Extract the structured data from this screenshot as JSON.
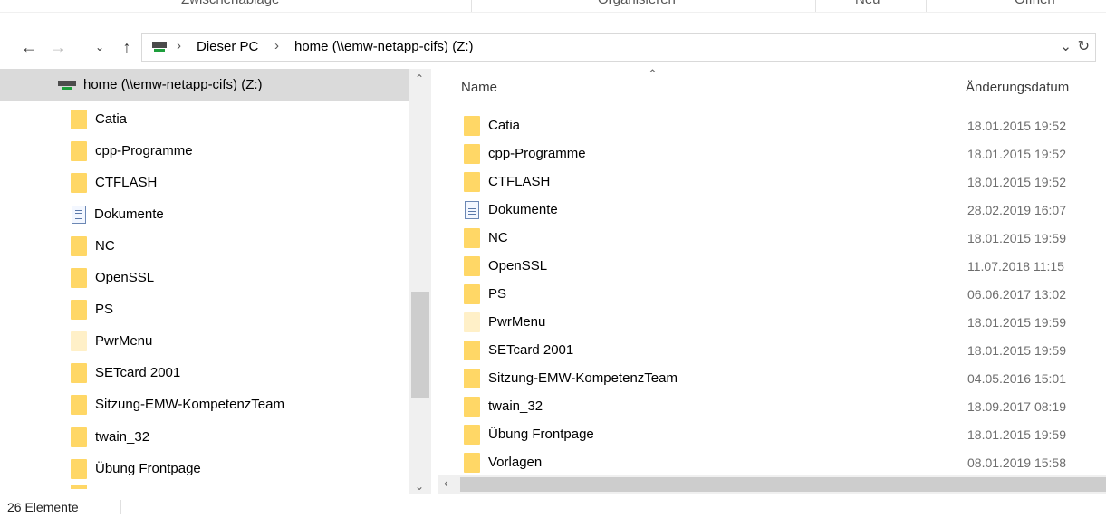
{
  "ribbon": {
    "groups": [
      "Zwischenablage",
      "Organisieren",
      "Neu",
      "Öffnen"
    ]
  },
  "nav": {
    "back_icon": "arrow-left-icon",
    "forward_icon": "arrow-right-icon",
    "recent_icon": "chevron-down-icon",
    "up_icon": "arrow-up-icon"
  },
  "address": {
    "breadcrumb": [
      "Dieser PC",
      "home (\\\\emw-netapp-cifs) (Z:)"
    ],
    "dropdown_icon": "chevron-down-icon",
    "refresh_icon": "refresh-icon"
  },
  "tree": {
    "selected": "home (\\\\emw-netapp-cifs) (Z:)",
    "items": [
      {
        "label": "Catia",
        "icon": "folder"
      },
      {
        "label": "cpp-Programme",
        "icon": "folder"
      },
      {
        "label": "CTFLASH",
        "icon": "folder"
      },
      {
        "label": "Dokumente",
        "icon": "document"
      },
      {
        "label": "NC",
        "icon": "folder"
      },
      {
        "label": "OpenSSL",
        "icon": "folder"
      },
      {
        "label": "PS",
        "icon": "folder"
      },
      {
        "label": "PwrMenu",
        "icon": "folder-hidden"
      },
      {
        "label": "SETcard 2001",
        "icon": "folder"
      },
      {
        "label": "Sitzung-EMW-KompetenzTeam",
        "icon": "folder"
      },
      {
        "label": "twain_32",
        "icon": "folder"
      },
      {
        "label": "Übung Frontpage",
        "icon": "folder"
      }
    ]
  },
  "list": {
    "columns": {
      "name": "Name",
      "modified": "Änderungsdatum"
    },
    "rows": [
      {
        "name": "Catia",
        "date": "18.01.2015 19:52",
        "icon": "folder"
      },
      {
        "name": "cpp-Programme",
        "date": "18.01.2015 19:52",
        "icon": "folder"
      },
      {
        "name": "CTFLASH",
        "date": "18.01.2015 19:52",
        "icon": "folder"
      },
      {
        "name": "Dokumente",
        "date": "28.02.2019 16:07",
        "icon": "document"
      },
      {
        "name": "NC",
        "date": "18.01.2015 19:59",
        "icon": "folder"
      },
      {
        "name": "OpenSSL",
        "date": "11.07.2018 11:15",
        "icon": "folder"
      },
      {
        "name": "PS",
        "date": "06.06.2017 13:02",
        "icon": "folder"
      },
      {
        "name": "PwrMenu",
        "date": "18.01.2015 19:59",
        "icon": "folder-hidden"
      },
      {
        "name": "SETcard 2001",
        "date": "18.01.2015 19:59",
        "icon": "folder"
      },
      {
        "name": "Sitzung-EMW-KompetenzTeam",
        "date": "04.05.2016 15:01",
        "icon": "folder"
      },
      {
        "name": "twain_32",
        "date": "18.09.2017 08:19",
        "icon": "folder"
      },
      {
        "name": "Übung Frontpage",
        "date": "18.01.2015 19:59",
        "icon": "folder"
      },
      {
        "name": "Vorlagen",
        "date": "08.01.2019 15:58",
        "icon": "folder"
      }
    ]
  },
  "status": {
    "count": "26 Elemente"
  }
}
